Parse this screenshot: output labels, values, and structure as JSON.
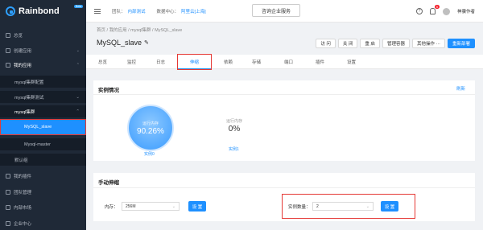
{
  "sidebar": {
    "logo": "Rainbond",
    "beta": "Beta",
    "items": [
      {
        "label": "总览"
      },
      {
        "label": "创建应用"
      },
      {
        "label": "我的应用"
      },
      {
        "label": "我的插件"
      },
      {
        "label": "团队管理"
      },
      {
        "label": "内部市场"
      },
      {
        "label": "企业中心"
      }
    ],
    "apps": [
      {
        "label": "mysql集群配置"
      },
      {
        "label": "mysql集群测试"
      },
      {
        "label": "mysql集群"
      }
    ],
    "components": [
      {
        "label": "MySQL_slave"
      },
      {
        "label": "Mysql-master"
      }
    ],
    "default_group": "默认组"
  },
  "topbar": {
    "team_label": "团队：",
    "team_value": "内部测试",
    "dc_label": "数据中心：",
    "dc_value": "阿里云[上海]",
    "consult": "咨询企业服务",
    "help": "?",
    "notifications": "5",
    "user": "神骥作者"
  },
  "breadcrumb": "首页 / 我的应用 / mysql集群 / MySQL_slave",
  "app": {
    "title": "MySQL_slave",
    "buttons": [
      "访 问",
      "关 闭",
      "重 启",
      "管理容器",
      "其他操作 ···"
    ],
    "deploy": "重新部署"
  },
  "tabs": [
    "总览",
    "监控",
    "日志",
    "伸缩",
    "依赖",
    "存储",
    "端口",
    "插件",
    "设置"
  ],
  "instances": {
    "title": "实例情况",
    "refresh": "刷新",
    "items": [
      {
        "label": "运行内存",
        "value": "90.26%",
        "link": "实例0"
      },
      {
        "label": "运行内存",
        "value": "0%",
        "link": "实例1"
      }
    ]
  },
  "scaling": {
    "title": "手动伸缩",
    "memory_label": "内存：",
    "memory_value": "256M",
    "set_label": "设 置",
    "count_label": "实例数量：",
    "count_value": "2",
    "set_label2": "设 置"
  }
}
